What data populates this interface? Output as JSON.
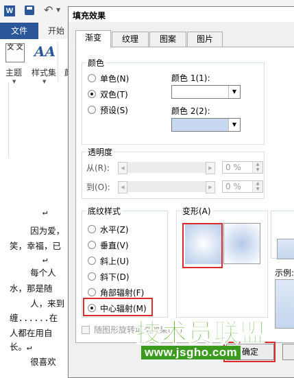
{
  "word": {
    "logo": "W",
    "tab_file": "文件",
    "tab_start": "开始",
    "ribbon": {
      "theme_label": "主题",
      "styles_label": "样式集",
      "extra_label": "颜",
      "theme_icon_text": "文 文"
    },
    "doc_lines": [
      "↵",
      "    因为爱，",
      "笑，幸福，已",
      "↵",
      "    每个人",
      "水，那是随",
      "    人，来到",
      "缠......在",
      "人都在用自",
      "长。↵",
      "    很喜欢"
    ]
  },
  "dialog": {
    "title": "填充效果",
    "tabs": [
      "渐变",
      "纹理",
      "图案",
      "图片"
    ],
    "active_tab": 0,
    "colors_group": {
      "label": "颜色",
      "options": [
        {
          "label": "单色(N)",
          "checked": false
        },
        {
          "label": "双色(T)",
          "checked": true
        },
        {
          "label": "预设(S)",
          "checked": false
        }
      ],
      "color1_label": "颜色 1(1):",
      "color1_value": "#ffffff",
      "color2_label": "颜色 2(2):",
      "color2_value": "#c8d8f0"
    },
    "transparency_group": {
      "label": "透明度",
      "from_label": "从(R):",
      "from_value": "0 %",
      "to_label": "到(O):",
      "to_value": "0 %"
    },
    "shading_group": {
      "label": "底纹样式",
      "options": [
        {
          "label": "水平(Z)",
          "checked": false
        },
        {
          "label": "垂直(V)",
          "checked": false
        },
        {
          "label": "斜上(U)",
          "checked": false
        },
        {
          "label": "斜下(D)",
          "checked": false
        },
        {
          "label": "角部辐射(F)",
          "checked": false
        },
        {
          "label": "中心辐射(M)",
          "checked": true
        }
      ]
    },
    "variants_group": {
      "label": "变形(A)"
    },
    "sample_label": "示例:",
    "rotate_checkbox_label": "随图形旋转填充效果(W)",
    "rotate_checked": false,
    "ok_label": "确定"
  },
  "watermark": {
    "main": "技术员联盟",
    "url": "www.jsgho.com"
  },
  "colors": {
    "word_blue": "#2b579a",
    "highlight_red": "#d92b2b",
    "watermark_green": "#4caf24"
  }
}
